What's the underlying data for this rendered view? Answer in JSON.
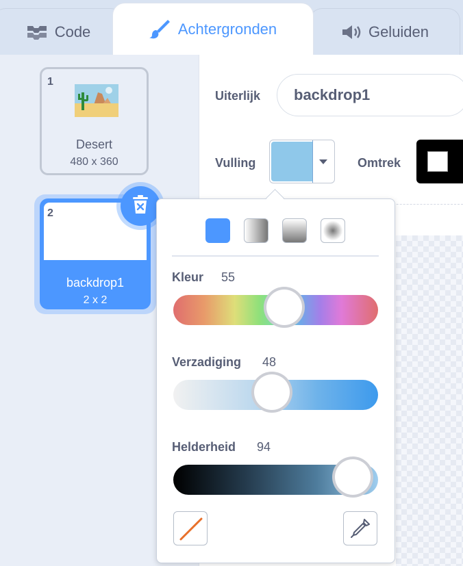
{
  "tabs": [
    {
      "label": "Code",
      "icon": "code-blocks-icon"
    },
    {
      "label": "Achtergronden",
      "icon": "paintbrush-icon",
      "active": true
    },
    {
      "label": "Geluiden",
      "icon": "speaker-icon"
    }
  ],
  "backdrops": [
    {
      "number": "1",
      "name": "Desert",
      "size": "480 x 360",
      "selected": false
    },
    {
      "number": "2",
      "name": "backdrop1",
      "size": "2 x 2",
      "selected": true
    }
  ],
  "editor": {
    "costume_label": "Uiterlijk",
    "costume_name": "backdrop1",
    "fill_label": "Vulling",
    "fill_color": "#8fc8ea",
    "outline_label": "Omtrek",
    "outline_color": "#000000"
  },
  "color_picker": {
    "fill_modes": [
      "solid",
      "horizontal-gradient",
      "vertical-gradient",
      "radial-gradient"
    ],
    "selected_mode": "solid",
    "hue": {
      "label": "Kleur",
      "value": "55"
    },
    "saturation": {
      "label": "Verzadiging",
      "value": "48"
    },
    "brightness": {
      "label": "Helderheid",
      "value": "94"
    },
    "accent_color": "#4c97ff"
  }
}
